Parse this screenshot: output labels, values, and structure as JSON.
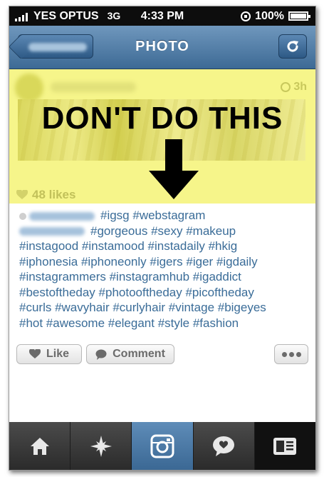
{
  "status_bar": {
    "carrier": "YES OPTUS",
    "network": "3G",
    "time": "4:33 PM",
    "battery": "100%"
  },
  "nav": {
    "title": "PHOTO",
    "back_icon": "chevron-left-icon",
    "refresh_icon": "refresh-icon"
  },
  "post": {
    "time_ago": "3h",
    "headline": "DON'T DO THIS",
    "likes": "48 likes",
    "caption_lines": [
      "#igsg #webstagram",
      "#gorgeous #sexy #makeup",
      "#instagood #instamood #instadaily #hkig",
      "#iphonesia #iphoneonly #igers #iger #igdaily",
      "#instagrammers #instagramhub #igaddict",
      "#bestoftheday #photooftheday #picoftheday",
      "#curls #wavyhair #curlyhair #vintage #bigeyes",
      "#hot #awesome #elegant #style #fashion"
    ]
  },
  "actions": {
    "like_label": "Like",
    "comment_label": "Comment"
  },
  "tabbar": {
    "tabs": [
      "home-icon",
      "explore-icon",
      "camera-icon",
      "news-icon",
      "profile-icon"
    ],
    "active": "camera-icon"
  },
  "colors": {
    "nav_blue": "#4e7aa5",
    "hashtag": "#3a6c98",
    "highlight": "#f6f58a"
  }
}
